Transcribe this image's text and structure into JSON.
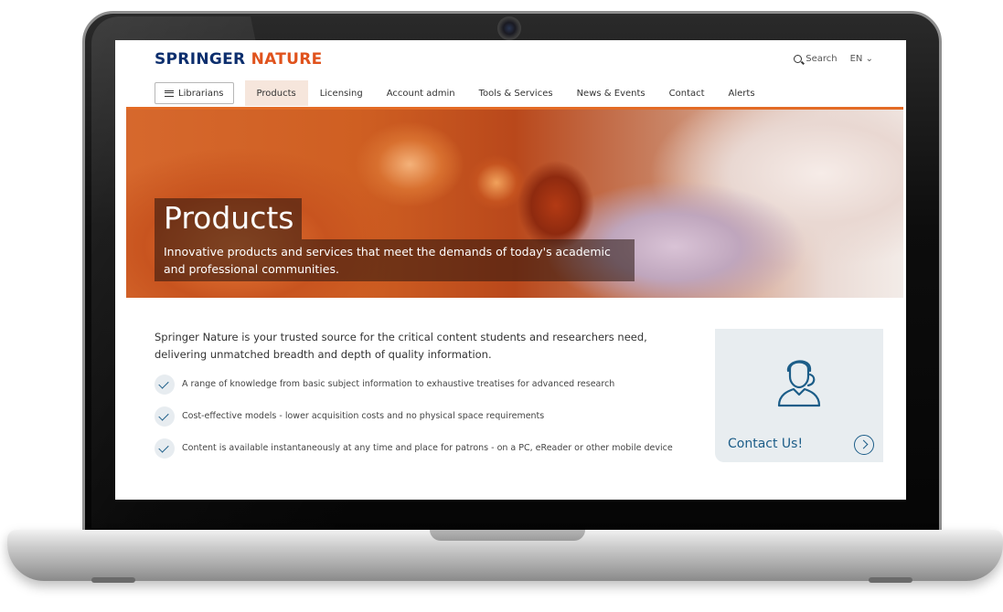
{
  "brand": {
    "logo_part1": "SPRINGER",
    "logo_part2": "NATURE",
    "primary_color": "#0d2f6e",
    "accent_color": "#e0531d"
  },
  "utility": {
    "search_label": "Search",
    "language": "EN"
  },
  "nav": {
    "menu_button": "Librarians",
    "items": [
      "Products",
      "Licensing",
      "Account admin",
      "Tools & Services",
      "News & Events",
      "Contact",
      "Alerts"
    ],
    "active": "Products"
  },
  "hero": {
    "title": "Products",
    "subtitle": "Innovative products and services that meet the demands of today's academic and professional communities."
  },
  "main": {
    "lead": "Springer Nature is your trusted source for the critical content students and researchers need, delivering unmatched breadth and depth of quality information.",
    "bullets": [
      "A range of knowledge from basic subject information to exhaustive treatises for advanced research",
      "Cost-effective models - lower acquisition costs and no physical space requirements",
      "Content is available instantaneously at any time and place for patrons - on a PC, eReader or other mobile device"
    ]
  },
  "contact_card": {
    "label": "Contact Us!",
    "icon": "person-icon"
  }
}
